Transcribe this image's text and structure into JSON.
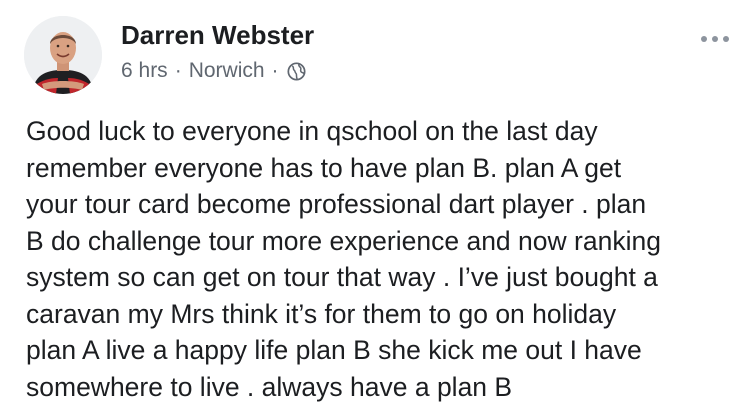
{
  "post": {
    "author": {
      "name": "Darren Webster",
      "avatar": "profile-photo"
    },
    "meta": {
      "time": "6 hrs",
      "separator": "·",
      "location": "Norwich",
      "privacy_icon": "globe-icon"
    },
    "menu_icon": "more-options-icon",
    "text_lines": [
      "Good luck to everyone in qschool on the last day",
      "remember everyone has to have plan B. plan A get",
      "your tour card become professional dart player . plan",
      "B do challenge tour more experience and now ranking",
      "system so can get on tour that way . I’ve just bought a",
      "caravan my Mrs think it’s for them to go on holiday",
      "plan A live a happy life plan B she kick me out I have",
      "somewhere to live . always have a plan B"
    ]
  },
  "colors": {
    "text": "#1c1e21",
    "meta": "#606770",
    "icon": "#8d949e",
    "background": "#ffffff"
  }
}
